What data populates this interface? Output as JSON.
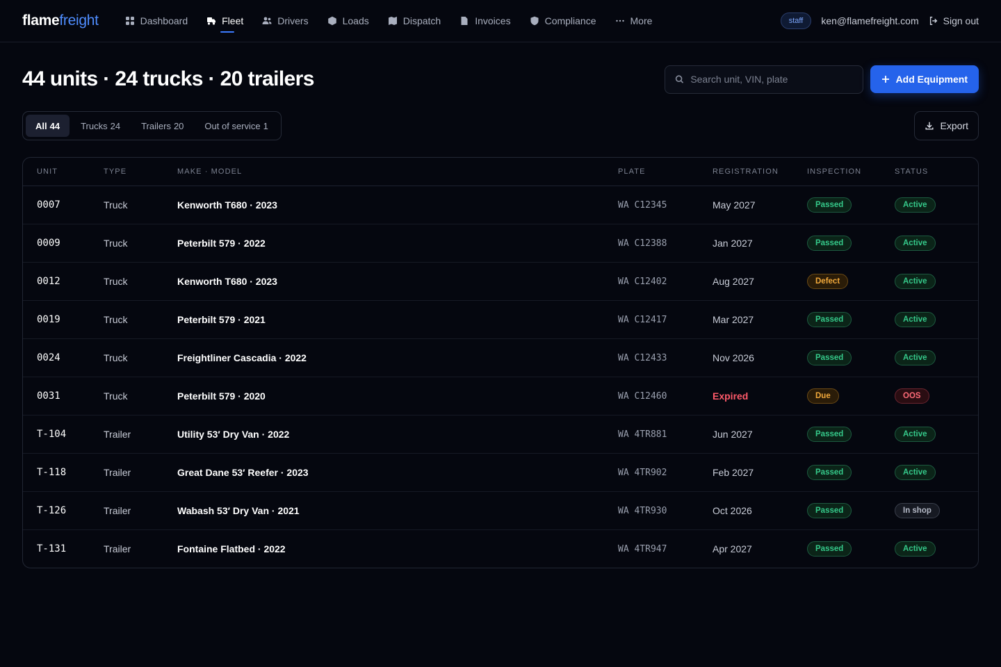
{
  "brand": {
    "first": "flame",
    "second": "freight"
  },
  "nav": [
    {
      "label": "Dashboard",
      "icon": "dashboard-icon"
    },
    {
      "label": "Fleet",
      "icon": "truck-icon",
      "active": true
    },
    {
      "label": "Drivers",
      "icon": "users-icon"
    },
    {
      "label": "Loads",
      "icon": "box-icon"
    },
    {
      "label": "Dispatch",
      "icon": "map-icon"
    },
    {
      "label": "Invoices",
      "icon": "document-icon"
    },
    {
      "label": "Compliance",
      "icon": "shield-icon"
    },
    {
      "label": "More",
      "icon": "more-icon"
    }
  ],
  "user": {
    "role": "staff",
    "email": "ken@flamefreight.com",
    "signout_label": "Sign out"
  },
  "page": {
    "title": "44 units · 24 trucks · 20 trailers"
  },
  "search": {
    "placeholder": "Search unit, VIN, plate",
    "value": ""
  },
  "add_button_label": "Add Equipment",
  "export_label": "Export",
  "filters": [
    {
      "label": "All",
      "count": "44",
      "active": true
    },
    {
      "label": "Trucks",
      "count": "24"
    },
    {
      "label": "Trailers",
      "count": "20"
    },
    {
      "label": "Out of service",
      "count": "1"
    }
  ],
  "table": {
    "headers": [
      "UNIT",
      "TYPE",
      "MAKE · MODEL",
      "PLATE",
      "REGISTRATION",
      "INSPECTION",
      "STATUS"
    ],
    "rows": [
      {
        "unit": "0007",
        "type": "Truck",
        "make": "Kenworth T680 · 2023",
        "plate": "WA C12345",
        "registration": "May 2027",
        "inspection": "Passed",
        "status": "Active"
      },
      {
        "unit": "0009",
        "type": "Truck",
        "make": "Peterbilt 579 · 2022",
        "plate": "WA C12388",
        "registration": "Jan 2027",
        "inspection": "Passed",
        "status": "Active"
      },
      {
        "unit": "0012",
        "type": "Truck",
        "make": "Kenworth T680 · 2023",
        "plate": "WA C12402",
        "registration": "Aug 2027",
        "inspection": "Defect",
        "status": "Active"
      },
      {
        "unit": "0019",
        "type": "Truck",
        "make": "Peterbilt 579 · 2021",
        "plate": "WA C12417",
        "registration": "Mar 2027",
        "inspection": "Passed",
        "status": "Active"
      },
      {
        "unit": "0024",
        "type": "Truck",
        "make": "Freightliner Cascadia · 2022",
        "plate": "WA C12433",
        "registration": "Nov 2026",
        "inspection": "Passed",
        "status": "Active"
      },
      {
        "unit": "0031",
        "type": "Truck",
        "make": "Peterbilt 579 · 2020",
        "plate": "WA C12460",
        "registration": "Expired",
        "inspection": "Due",
        "status": "OOS"
      },
      {
        "unit": "T-104",
        "type": "Trailer",
        "make": "Utility 53′ Dry Van · 2022",
        "plate": "WA 4TR881",
        "registration": "Jun 2027",
        "inspection": "Passed",
        "status": "Active"
      },
      {
        "unit": "T-118",
        "type": "Trailer",
        "make": "Great Dane 53′ Reefer · 2023",
        "plate": "WA 4TR902",
        "registration": "Feb 2027",
        "inspection": "Passed",
        "status": "Active"
      },
      {
        "unit": "T-126",
        "type": "Trailer",
        "make": "Wabash 53′ Dry Van · 2021",
        "plate": "WA 4TR930",
        "registration": "Oct 2026",
        "inspection": "Passed",
        "status": "In shop"
      },
      {
        "unit": "T-131",
        "type": "Trailer",
        "make": "Fontaine Flatbed · 2022",
        "plate": "WA 4TR947",
        "registration": "Apr 2027",
        "inspection": "Passed",
        "status": "Active"
      }
    ]
  },
  "colors": {
    "background": "#05070f",
    "accent": "#2563eb",
    "passed": "#35c98a",
    "warning": "#f2a93b",
    "danger": "#ff5a6a"
  }
}
